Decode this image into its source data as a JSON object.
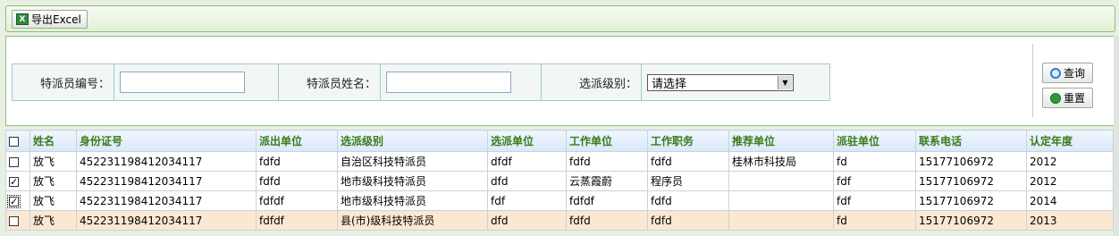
{
  "toolbar": {
    "export_label": "导出Excel",
    "export_icon": "excel-icon"
  },
  "search": {
    "id_label": "特派员编号：",
    "name_label": "特派员姓名：",
    "level_label": "选派级别：",
    "id_value": "",
    "name_value": "",
    "level_selected": "请选择"
  },
  "buttons": {
    "query": "查询",
    "reset": "重置"
  },
  "table": {
    "columns": [
      "姓名",
      "身份证号",
      "派出单位",
      "选派级别",
      "选派单位",
      "工作单位",
      "工作职务",
      "推荐单位",
      "派驻单位",
      "联系电话",
      "认定年度"
    ],
    "rows": [
      {
        "checked": false,
        "cells": [
          "放飞",
          "452231198412034117",
          "fdfd",
          "自治区科技特派员",
          "dfdf",
          "fdfd",
          "fdfd",
          "桂林市科技局",
          "fd",
          "15177106972",
          "2012"
        ]
      },
      {
        "checked": true,
        "cells": [
          "放飞",
          "452231198412034117",
          "fdfd",
          "地市级科技特派员",
          "dfd",
          "云蒸霞蔚",
          "程序员",
          "",
          "fdf",
          "15177106972",
          "2012"
        ]
      },
      {
        "checked": true,
        "cells": [
          "放飞",
          "452231198412034117",
          "fdfdf",
          "地市级科技特派员",
          "fdf",
          "fdfdf",
          "fdfd",
          "",
          "fdf",
          "15177106972",
          "2014"
        ]
      },
      {
        "checked": false,
        "cells": [
          "放飞",
          "452231198412034117",
          "fdfdf",
          "县(市)级科技特派员",
          "dfd",
          "fdfd",
          "fdfd",
          "",
          "fd",
          "15177106972",
          "2013"
        ]
      }
    ]
  },
  "colors": {
    "header_text": "#3a7a1a",
    "highlight_row": "#fbe8d2",
    "panel_border": "#8cbf7a"
  }
}
